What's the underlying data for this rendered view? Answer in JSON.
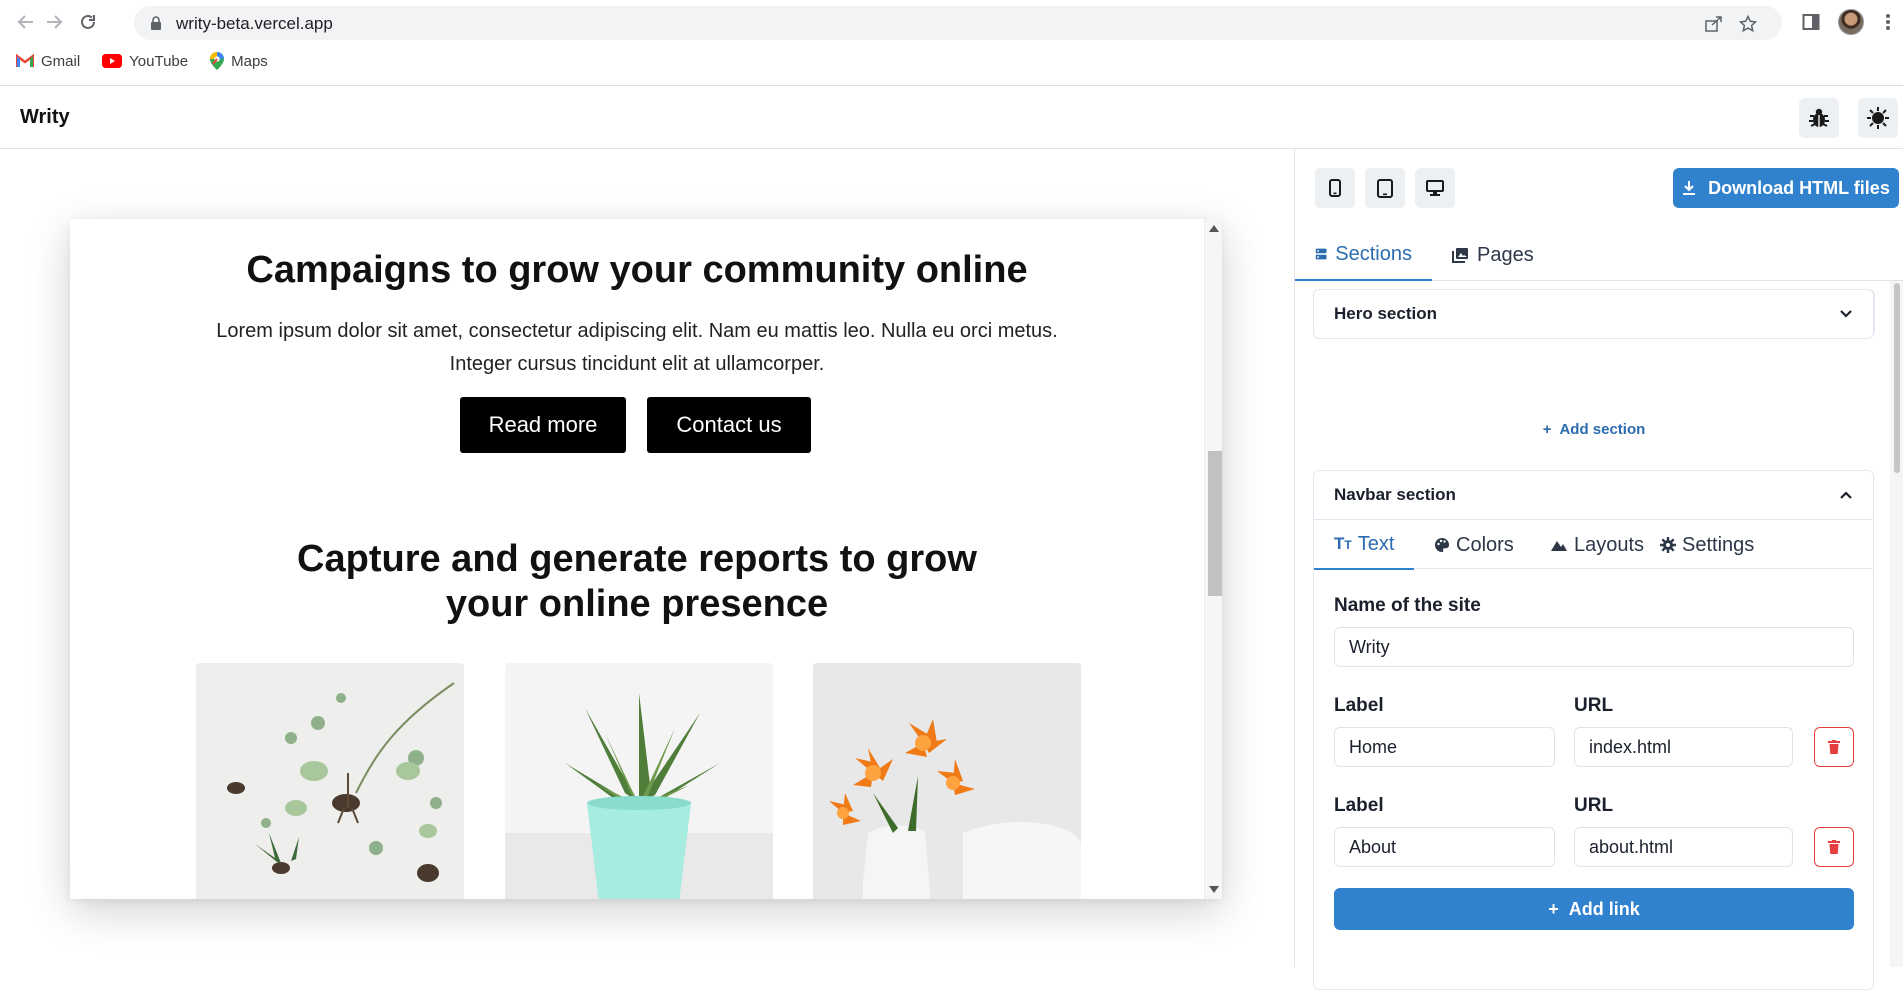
{
  "browser": {
    "url": "writy-beta.vercel.app",
    "bookmarks": [
      {
        "label": "Gmail",
        "icon": "gmail-icon"
      },
      {
        "label": "YouTube",
        "icon": "youtube-icon"
      },
      {
        "label": "Maps",
        "icon": "maps-icon"
      }
    ]
  },
  "app": {
    "title": "Writy",
    "header_icons": [
      "bug-icon",
      "theme-toggle-icon"
    ]
  },
  "preview": {
    "hero_heading": "Campaigns to grow your community online",
    "hero_text": "Lorem ipsum dolor sit amet, consectetur adipiscing elit. Nam eu mattis leo. Nulla eu orci metus. Integer cursus tincidunt elit at ullamcorper.",
    "buttons": [
      "Read more",
      "Contact us"
    ],
    "section_heading": "Capture and generate reports to grow your online presence",
    "images": [
      "succulents",
      "potted-aloe",
      "orange-lilies"
    ]
  },
  "panel": {
    "device_icons": [
      "mobile-icon",
      "tablet-icon",
      "desktop-icon"
    ],
    "download_label": "Download HTML files",
    "tabs": [
      {
        "label": "Sections",
        "icon": "sections-icon",
        "active": true
      },
      {
        "label": "Pages",
        "icon": "pages-icon",
        "active": false
      }
    ],
    "add_section_label": "Add section",
    "sections": [
      {
        "title": "Hero section",
        "expanded": false
      },
      {
        "title": "Navbar section",
        "expanded": true
      }
    ],
    "navbar_tabs": [
      {
        "label": "Text",
        "icon": "text-icon",
        "active": true
      },
      {
        "label": "Colors",
        "icon": "palette-icon",
        "active": false
      },
      {
        "label": "Layouts",
        "icon": "layouts-icon",
        "active": false
      },
      {
        "label": "Settings",
        "icon": "gear-icon",
        "active": false
      }
    ],
    "site_name_label": "Name of the site",
    "site_name_value": "Writy",
    "links": [
      {
        "label_title": "Label",
        "url_title": "URL",
        "label": "Home",
        "url": "index.html"
      },
      {
        "label_title": "Label",
        "url_title": "URL",
        "label": "About",
        "url": "about.html"
      }
    ],
    "add_link_label": "Add link"
  },
  "colors": {
    "accent": "#3182ce",
    "accent_text": "#2b6cb0",
    "danger": "#e53e3e",
    "cta_bg": "#000000"
  }
}
